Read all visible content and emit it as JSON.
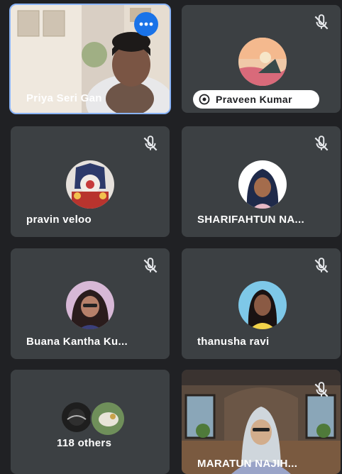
{
  "participants": [
    {
      "name": "Priya Seri Gan",
      "active": true,
      "muted": false,
      "video": true
    },
    {
      "name": "Praveen Kumar",
      "muted": true,
      "has_label_pill": true
    },
    {
      "name": "pravin veloo",
      "muted": true
    },
    {
      "name": "SHARIFAHTUN NA...",
      "muted": true
    },
    {
      "name": "Buana Kantha Ku...",
      "muted": true
    },
    {
      "name": "thanusha ravi",
      "muted": true
    },
    {
      "name": "MARATUN NAJIH...",
      "muted": true,
      "video": true
    }
  ],
  "others": {
    "label": "118 others"
  },
  "colors": {
    "background": "#202124",
    "tile": "#3c4043",
    "active_outline": "#8ab4f8",
    "more_button": "#1a73e8"
  },
  "icons": {
    "mic_off": "mic-off-icon",
    "more": "more-options-icon",
    "pin": "participant-mic-icon"
  }
}
